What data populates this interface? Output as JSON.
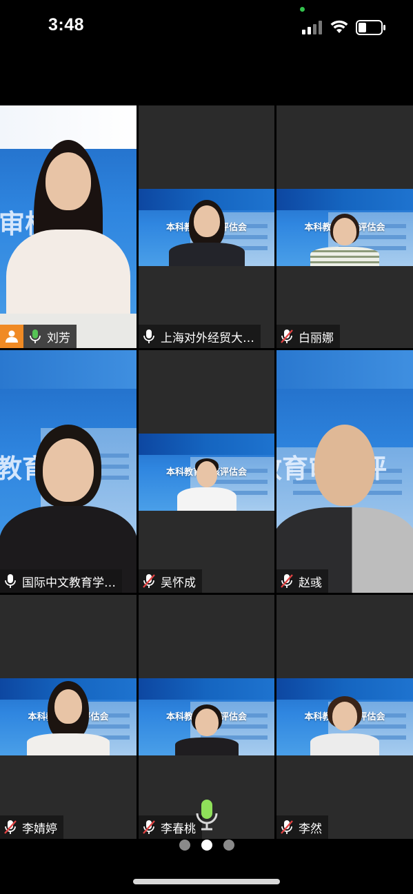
{
  "status_bar": {
    "time": "3:48",
    "icons": [
      "signal-icon",
      "wifi-icon",
      "battery-icon"
    ],
    "privacy_indicator_color": "#33c24d"
  },
  "colors": {
    "active_speaker_border": "#56c455",
    "host_badge": "#f08a24",
    "tile_background": "#2b2b2b",
    "muted_icon": "#e04343"
  },
  "participants": [
    {
      "name": "刘芳",
      "mic": "unmuted",
      "active_speaker": true,
      "is_host": true
    },
    {
      "name": "上海对外经贸大…",
      "mic": "unmuted",
      "active_speaker": false,
      "is_host": false,
      "background_title": "本科教育审核评估会"
    },
    {
      "name": "白丽娜",
      "mic": "muted",
      "active_speaker": false,
      "is_host": false,
      "background_title": "本科教育审核评估会"
    },
    {
      "name": "国际中文教育学…",
      "mic": "unmuted",
      "active_speaker": false,
      "is_host": false
    },
    {
      "name": "吴怀成",
      "mic": "muted",
      "active_speaker": false,
      "is_host": false,
      "background_title": "本科教育审核评估会"
    },
    {
      "name": "赵彧",
      "mic": "muted",
      "active_speaker": false,
      "is_host": false
    },
    {
      "name": "李婧婷",
      "mic": "muted",
      "active_speaker": false,
      "is_host": false,
      "background_title": "本科教育审核评估会"
    },
    {
      "name": "李春桃",
      "mic": "muted",
      "active_speaker": false,
      "is_host": false,
      "background_title": "本科教育审核评估会"
    },
    {
      "name": "李然",
      "mic": "muted",
      "active_speaker": false,
      "is_host": false,
      "background_title": "本科教育审核评估会"
    }
  ],
  "background_overlay": {
    "tile1_text": "育审核评",
    "tile4_text": "教育",
    "tile6_text": "教育审核评"
  },
  "pagination": {
    "pages": 3,
    "current": 2
  }
}
